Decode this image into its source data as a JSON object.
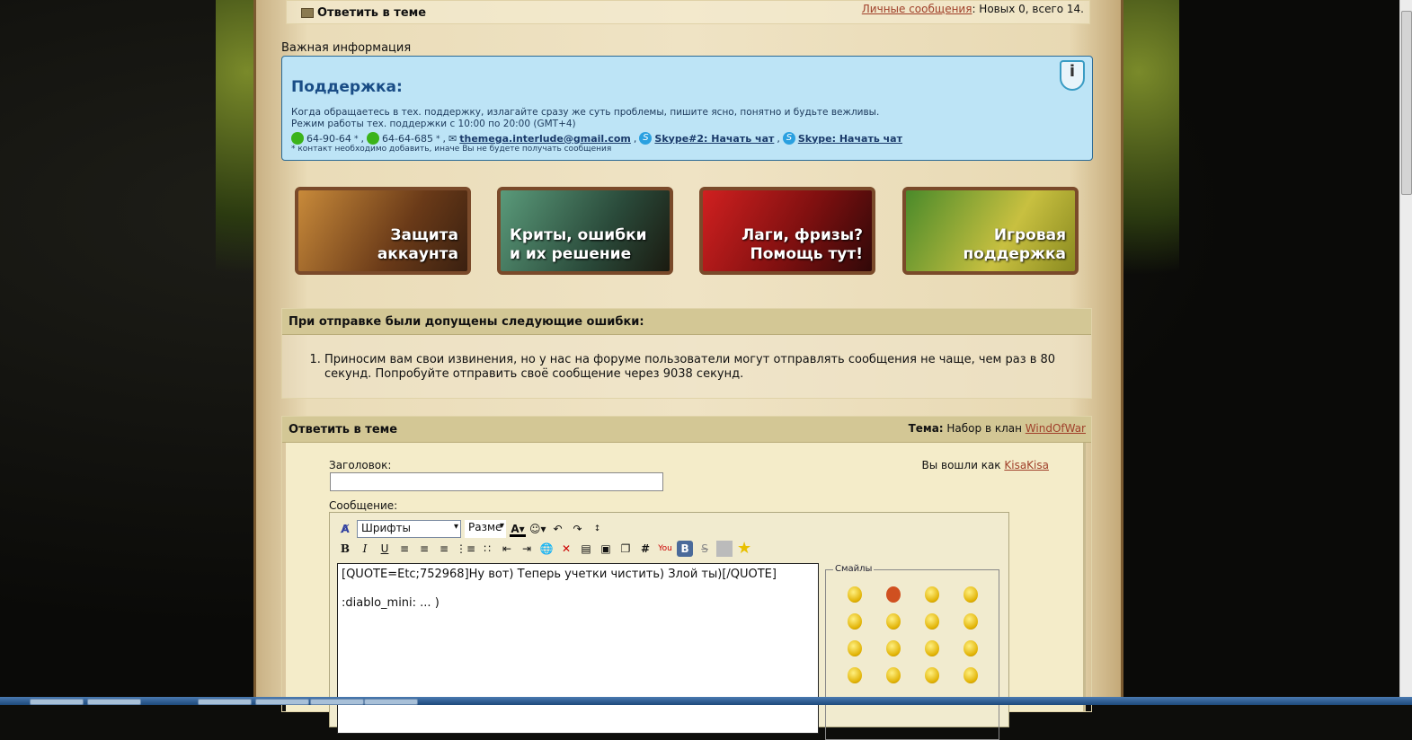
{
  "topbar": {
    "reply_label": "Ответить в теме",
    "pm_link": "Личные сообщения",
    "pm_status": ": Новых 0, всего 14."
  },
  "important_label": "Важная информация",
  "support": {
    "title": "Поддержка:",
    "line1": "Когда обращаетесь в тех. поддержку, излагайте сразу же суть проблемы, пишите ясно, понятно и будьте вежливы.",
    "line2": "Режим работы тех. поддержки с 10:00 по 20:00 (GMT+4)",
    "icq1": "64-90-64",
    "icq2": "64-64-685",
    "email": "themega.interlude@gmail.com",
    "skype2": "Skype#2: Начать чат",
    "skype1": "Skype: Начать чат",
    "note": "* контакт необходимо добавить, иначе Вы не будете получать сообщения"
  },
  "banners": [
    {
      "label": "Защита аккаунта"
    },
    {
      "label": "Криты, ошибки и их решение"
    },
    {
      "label": "Лаги, фризы? Помощь тут!"
    },
    {
      "label": "Игровая поддержка"
    }
  ],
  "errors": {
    "title": "При отправке были допущены следующие ошибки:",
    "items": [
      "Приносим вам свои извинения, но у нас на форуме пользователи могут отправлять сообщения не чаще, чем раз в 80 секунд. Попробуйте отправить своё сообщение через 9038 секунд."
    ]
  },
  "reply": {
    "title": "Ответить в теме",
    "topic_label": "Тема:",
    "topic_prefix": " Набор в клан ",
    "topic_link": "WindOfWar",
    "subject_label": "Заголовок:",
    "subject_value": "",
    "logged_as": "Вы вошли как ",
    "user": "KisaKisa",
    "message_label": "Сообщение:",
    "font_select": "Шрифты",
    "size_select": "Разме",
    "message": "[QUOTE=Etc;752968]Ну вот) Теперь учетки чистить) Злой ты)[/QUOTE]\n\n:diablo_mini: ... )",
    "smilies_label": "Смайлы"
  }
}
